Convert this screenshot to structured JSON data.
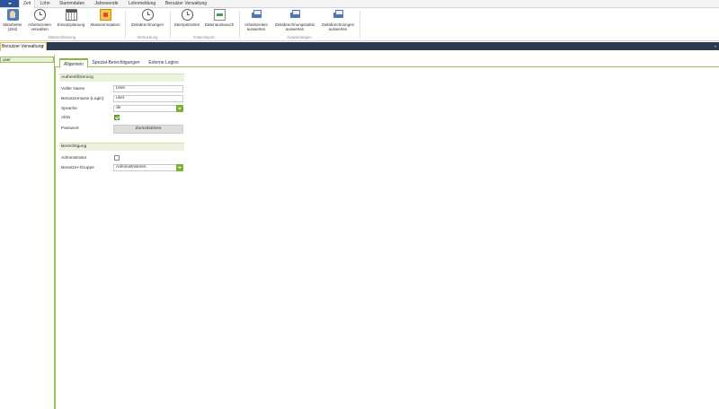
{
  "menubar": {
    "tabs": [
      "Zeit",
      "Lohn",
      "Stammdaten",
      "Jahresende",
      "Lohnmeldung",
      "Benutzer Verwaltung"
    ],
    "active": "Zeit"
  },
  "ribbon": {
    "groups": [
      {
        "label": "Datenerfassung",
        "buttons": [
          {
            "label": "Mitarbeiter\n(Zeit)",
            "icon": "employee-icon"
          },
          {
            "label": "Arbeitszeiten\nverwalten",
            "icon": "clock-icon"
          },
          {
            "label": "Einsatzplanung",
            "icon": "calendar-icon"
          },
          {
            "label": "Massenmutation",
            "icon": "mass-mutation-icon"
          }
        ]
      },
      {
        "label": "Verbuchung",
        "buttons": [
          {
            "label": "Zeitabrechnungen",
            "icon": "clock-icon"
          }
        ]
      },
      {
        "label": "Datenimport",
        "buttons": [
          {
            "label": "Stempelzeiten",
            "icon": "clock-icon"
          },
          {
            "label": "Datenaustausch",
            "icon": "exchange-icon"
          }
        ]
      },
      {
        "label": "Auswertungen",
        "buttons": [
          {
            "label": "Arbeitszeiten\nauswerten",
            "icon": "printer-icon"
          },
          {
            "label": "Zeitabrechnungssaldo\nauswerten",
            "icon": "printer-icon"
          },
          {
            "label": "Zeitabrechnungen\nauswerten",
            "icon": "printer-icon"
          }
        ]
      }
    ]
  },
  "doc_tab": {
    "label": "Benutzer Verwaltung",
    "close": "×"
  },
  "left_panel": {
    "selected_item": "user"
  },
  "tabs": [
    "Allgemein",
    "Spezial-Berechtigungen",
    "Externe Logins"
  ],
  "active_tab": "Allgemein",
  "form": {
    "section_auth": "Authentifizierung",
    "full_name_label": "Voller Name",
    "full_name_value": "User",
    "username_label": "Benutzername (Login)",
    "username_value": "user",
    "language_label": "Sprache",
    "language_value": "de",
    "active_label": "Aktiv",
    "active_checked": true,
    "password_label": "Passwort",
    "reset_button": "Zurücksetzen",
    "section_perm": "Berechtigung",
    "admin_label": "Administrator",
    "admin_checked": false,
    "group_label": "Benutzer-Gruppe",
    "group_value": "Administratoren"
  },
  "colors": {
    "accent": "#7ab33a",
    "dark_bar": "#2e3a50",
    "app_button": "#2b579a"
  }
}
